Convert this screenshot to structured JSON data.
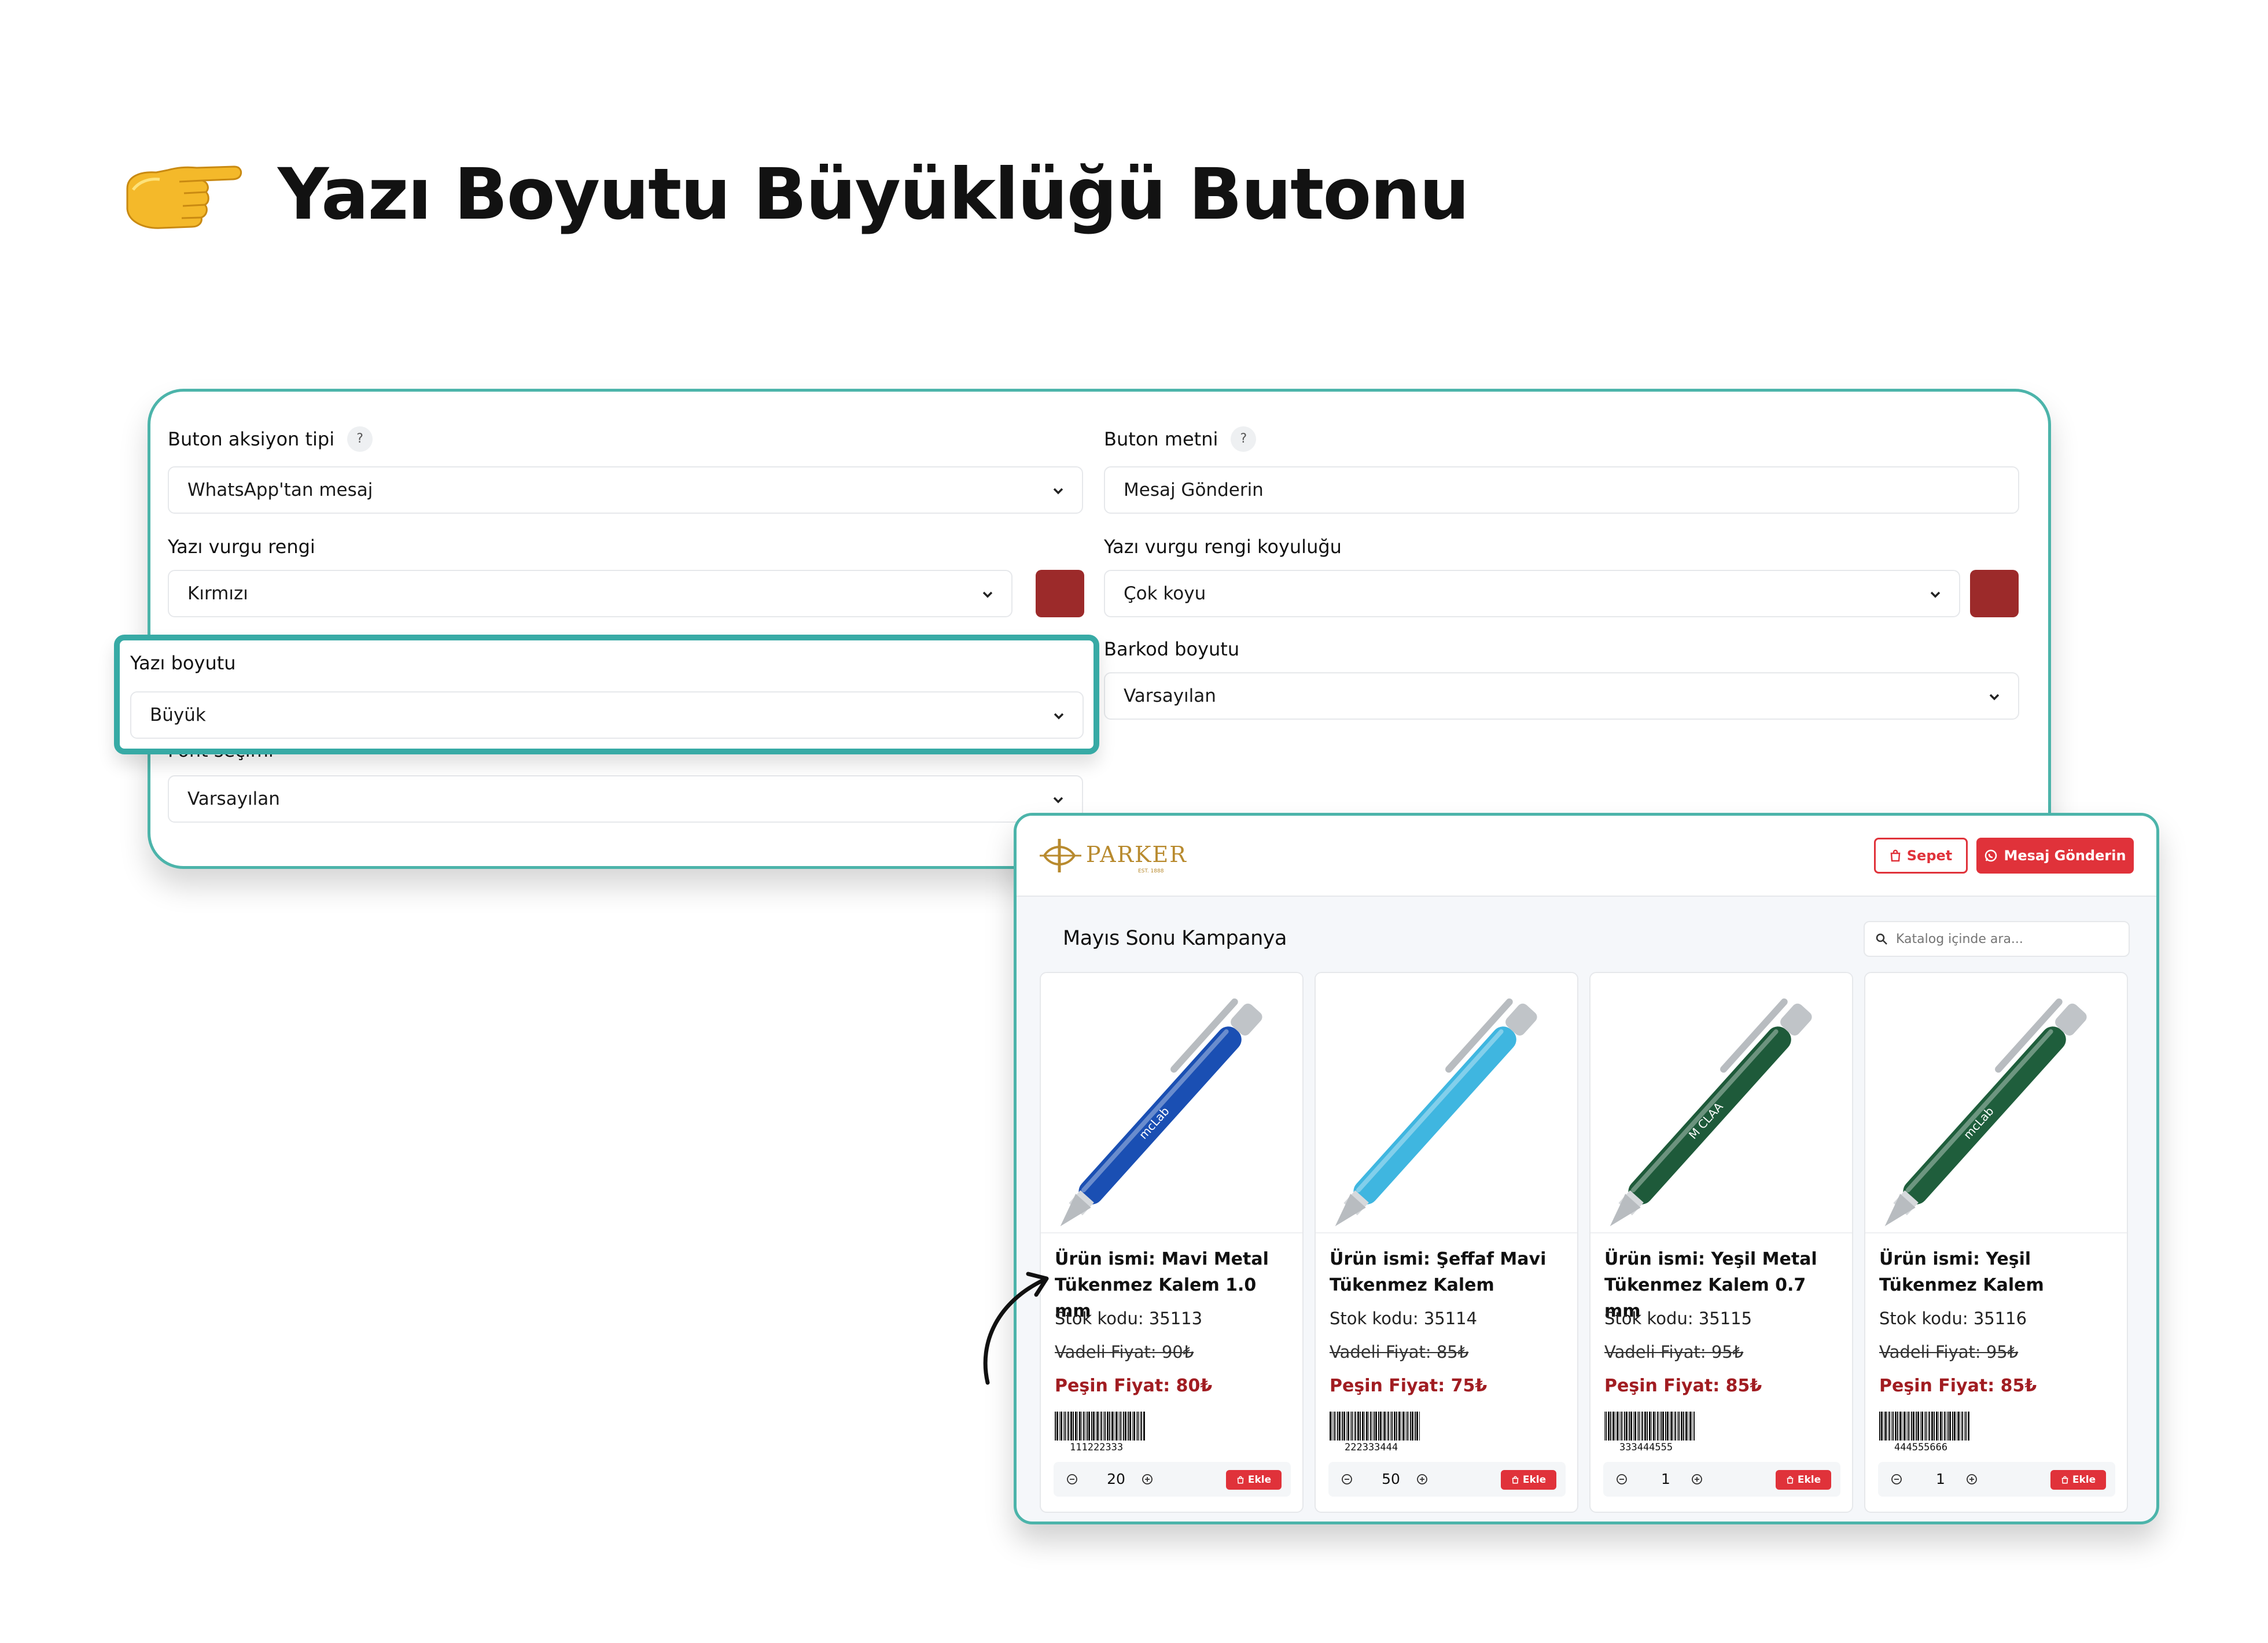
{
  "headline": {
    "title": "Yazı Boyutu Büyüklüğü Butonu",
    "icon": "pointing-hand-icon"
  },
  "settings": {
    "action_type": {
      "label": "Buton aksiyon tipi",
      "help": "?",
      "value": "WhatsApp'tan mesaj"
    },
    "button_text": {
      "label": "Buton metni",
      "help": "?",
      "value": "Mesaj Gönderin"
    },
    "accent_color": {
      "label": "Yazı vurgu rengi",
      "value": "Kırmızı",
      "swatch": "#9c2a2a"
    },
    "accent_shade": {
      "label": "Yazı vurgu rengi koyuluğu",
      "value": "Çok koyu",
      "swatch": "#9c2a2a"
    },
    "font_size": {
      "label": "Yazı boyutu",
      "value": "Büyük"
    },
    "barcode_size": {
      "label": "Barkod boyutu",
      "value": "Varsayılan"
    },
    "font_family": {
      "label": "Font seçimi",
      "value": "Varsayılan"
    }
  },
  "catalog": {
    "brand": "PARKER",
    "brand_sub": "EST. 1888",
    "cart_label": "Sepet",
    "message_label": "Mesaj Gönderin",
    "title": "Mayıs Sonu Kampanya",
    "search_placeholder": "Katalog içinde ara...",
    "accent": "#e0323a",
    "add_label": "Ekle",
    "products": [
      {
        "name": "Ürün ismi: Mavi Metal Tükenmez Kalem 1.0 mm",
        "stock": "Stok kodu: 35113",
        "old_price": "Vadeli Fiyat: 90₺",
        "cash_price": "Peşin Fiyat: 80₺",
        "barcode": "111222333",
        "qty": "20",
        "pen_color": "#1a4fb3",
        "pen_text": "mcLab"
      },
      {
        "name": "Ürün ismi: Şeffaf Mavi Tükenmez Kalem",
        "stock": "Stok kodu: 35114",
        "old_price": "Vadeli Fiyat: 85₺",
        "cash_price": "Peşin Fiyat: 75₺",
        "barcode": "222333444",
        "qty": "50",
        "pen_color": "#3fb6e0",
        "pen_text": ""
      },
      {
        "name": "Ürün ismi: Yeşil Metal Tükenmez Kalem 0.7 mm",
        "stock": "Stok kodu: 35115",
        "old_price": "Vadeli Fiyat: 95₺",
        "cash_price": "Peşin Fiyat: 85₺",
        "barcode": "333444555",
        "qty": "1",
        "pen_color": "#1e5a3a",
        "pen_text": "M CLAA"
      },
      {
        "name": "Ürün ismi: Yeşil Tükenmez Kalem",
        "stock": "Stok kodu: 35116",
        "old_price": "Vadeli Fiyat: 95₺",
        "cash_price": "Peşin Fiyat: 85₺",
        "barcode": "444555666",
        "qty": "1",
        "pen_color": "#1f5e3c",
        "pen_text": "mcLab"
      }
    ]
  }
}
